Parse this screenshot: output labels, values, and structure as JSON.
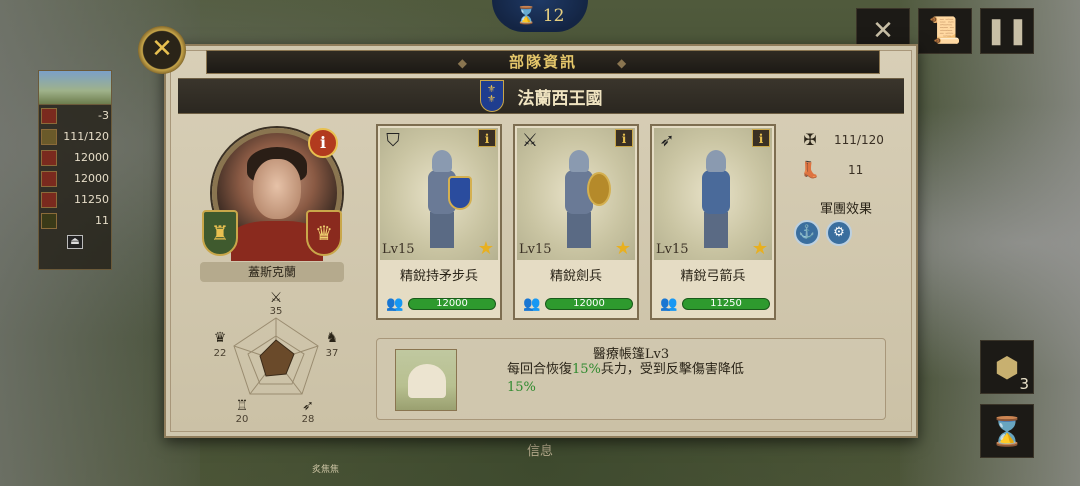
{
  "turn": {
    "value": "12"
  },
  "left_stats": [
    {
      "icon": "attack-icon",
      "value": "-3"
    },
    {
      "icon": "troop-icon",
      "value": "111/120"
    },
    {
      "icon": "defense-icon",
      "value": "12000"
    },
    {
      "icon": "sword-icon",
      "value": "12000"
    },
    {
      "icon": "bow-icon",
      "value": "11250"
    },
    {
      "icon": "move-icon",
      "value": "11"
    }
  ],
  "panel": {
    "title": "部隊資訊",
    "nation": "法蘭西王國"
  },
  "general": {
    "name": "蓋斯克蘭",
    "stats": {
      "attack": "35",
      "cavalry": "37",
      "archery": "28",
      "defense": "20",
      "command": "22"
    }
  },
  "units": [
    {
      "type_icon": "shield-icon",
      "level": "Lv15",
      "name": "精銳持矛步兵",
      "troops": "12000"
    },
    {
      "type_icon": "sword-icon",
      "level": "Lv15",
      "name": "精銳劍兵",
      "troops": "12000"
    },
    {
      "type_icon": "bow-icon",
      "level": "Lv15",
      "name": "精銳弓箭兵",
      "troops": "11250"
    }
  ],
  "summary": {
    "troops": "111/120",
    "move": "11",
    "legion_effect_label": "軍團效果"
  },
  "effect": {
    "title": "醫療帳篷Lv3",
    "text_a": "每回合恢復",
    "pct_a": "15%",
    "text_b": "兵力，受到反擊傷害降低",
    "pct_b": "15%"
  },
  "bottom": {
    "label": "信息",
    "unit_name": "炙焦焦"
  },
  "hex_count": "3"
}
